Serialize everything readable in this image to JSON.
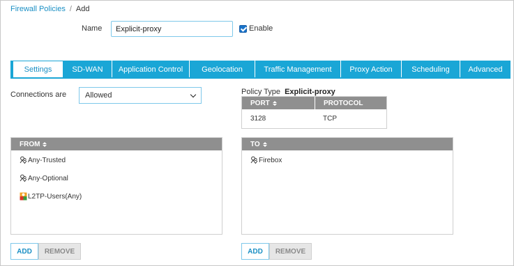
{
  "breadcrumb": {
    "parent": "Firewall Policies",
    "separator": "/",
    "current": "Add"
  },
  "name_field": {
    "label": "Name",
    "value": "Explicit-proxy"
  },
  "enable": {
    "label": "Enable",
    "checked": true
  },
  "tabs": [
    {
      "label": "Settings",
      "active": true
    },
    {
      "label": "SD-WAN"
    },
    {
      "label": "Application Control"
    },
    {
      "label": "Geolocation"
    },
    {
      "label": "Traffic Management"
    },
    {
      "label": "Proxy Action"
    },
    {
      "label": "Scheduling"
    },
    {
      "label": "Advanced"
    }
  ],
  "connections": {
    "label": "Connections are",
    "selected": "Allowed"
  },
  "policy_type": {
    "label": "Policy Type",
    "value": "Explicit-proxy"
  },
  "port_table": {
    "headers": [
      "PORT",
      "PROTOCOL"
    ],
    "rows": [
      {
        "port": "3128",
        "protocol": "TCP"
      }
    ]
  },
  "from_list": {
    "header": "FROM",
    "items": [
      {
        "label": "Any-Trusted",
        "icon": "alias-icon"
      },
      {
        "label": "Any-Optional",
        "icon": "alias-icon"
      },
      {
        "label": "L2TP-Users(Any)",
        "icon": "l2tp-users-icon"
      }
    ],
    "add_label": "ADD",
    "remove_label": "REMOVE"
  },
  "to_list": {
    "header": "TO",
    "items": [
      {
        "label": "Firebox",
        "icon": "alias-icon"
      }
    ],
    "add_label": "ADD",
    "remove_label": "REMOVE"
  },
  "colors": {
    "accent": "#1aa6d6",
    "link": "#1a8fc4",
    "header_gray": "#8f8f8f",
    "checkbox": "#1a73c9"
  }
}
